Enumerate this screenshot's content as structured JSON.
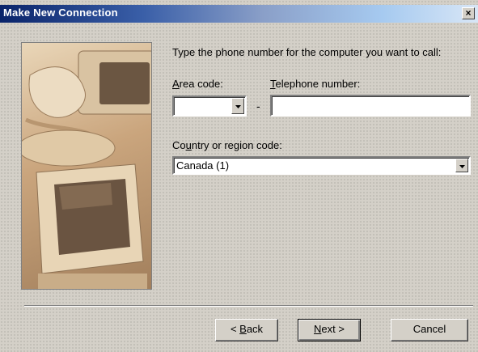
{
  "window": {
    "title": "Make New Connection",
    "close_glyph": "×"
  },
  "art": {
    "description_icon": "computer-phone-illustration"
  },
  "form": {
    "prompt": "Type the phone number for the computer you want to call:",
    "area_code": {
      "accel": "A",
      "rest": "rea code:",
      "value": ""
    },
    "telephone": {
      "accel": "T",
      "rest": "elephone number:",
      "value": ""
    },
    "dash": "-",
    "country": {
      "pre": "Co",
      "accel": "u",
      "rest": "ntry or region code:",
      "value": "Canada (1)"
    }
  },
  "buttons": {
    "back": {
      "prefix": "< ",
      "accel": "B",
      "rest": "ack"
    },
    "next": {
      "accel": "N",
      "rest": "ext >"
    },
    "cancel": "Cancel"
  }
}
